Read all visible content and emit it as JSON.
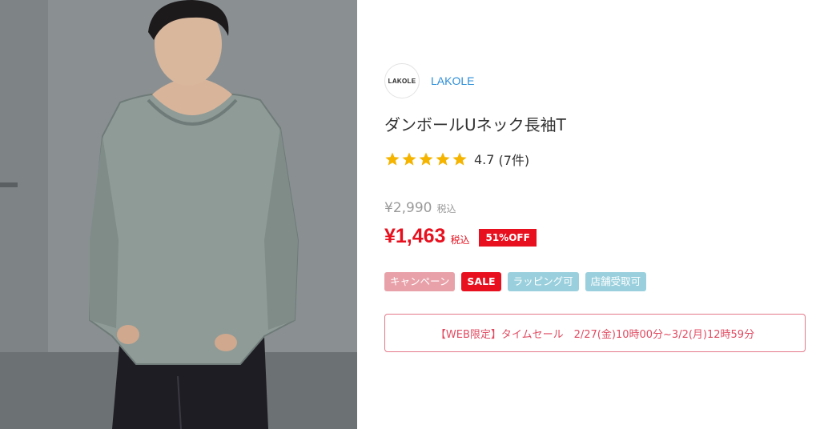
{
  "photo": {
    "alt_icon": "model-photo"
  },
  "brand": {
    "logo_text": "LAKOLE",
    "name": "LAKOLE"
  },
  "product": {
    "title": "ダンボールUネック長袖T"
  },
  "rating": {
    "score": "4.7",
    "count": "(7件)",
    "stars": 5
  },
  "price": {
    "original": "¥2,990",
    "original_tax": "税込",
    "sale": "¥1,463",
    "sale_tax": "税込",
    "discount": "51%OFF"
  },
  "tags": {
    "campaign": "キャンペーン",
    "sale": "SALE",
    "wrapping": "ラッピング可",
    "store_pickup": "店舗受取可"
  },
  "notice": {
    "text": "【WEB限定】タイムセール　2/27(金)10時00分~3/2(月)12時59分"
  },
  "colors": {
    "accent_red": "#e8101e",
    "brand_blue": "#2d8ed8",
    "star": "#f5b400",
    "tag_blue": "#9ad0dd",
    "tag_pink": "#e8a1a9"
  }
}
